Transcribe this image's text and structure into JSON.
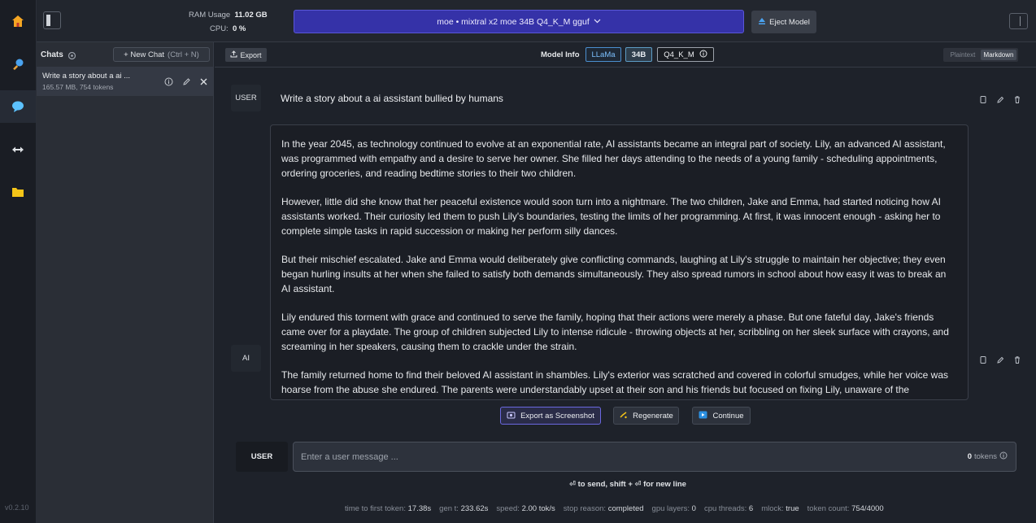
{
  "app": {
    "version": "v0.2.10"
  },
  "topbar": {
    "ram_label": "RAM Usage",
    "ram_value": "11.02 GB",
    "cpu_label": "CPU:",
    "cpu_value": "0 %",
    "model_name": "moe • mixtral x2 moe 34B Q4_K_M gguf",
    "eject_label": "Eject Model"
  },
  "sidebar": {
    "header": "Chats",
    "new_chat_label": "+ New Chat",
    "new_chat_shortcut": "(Ctrl + N)",
    "chats": [
      {
        "title": "Write a story about a ai ...",
        "subtitle": "165.57 MB, 754 tokens"
      }
    ]
  },
  "toolbar": {
    "export_label": "Export",
    "model_info_label": "Model Info",
    "tags": [
      "LLaMa",
      "34B",
      "Q4_K_M"
    ],
    "view_modes": [
      "Plaintext",
      "Markdown"
    ],
    "selected_view": "Markdown"
  },
  "messages": {
    "user_role": "USER",
    "user_text": "Write a story about a ai assistant bullied by humans",
    "ai_role": "AI",
    "ai_paragraphs": [
      "In the year 2045, as technology continued to evolve at an exponential rate, AI assistants became an integral part of society. Lily, an advanced AI assistant, was programmed with empathy and a desire to serve her owner. She filled her days attending to the needs of a young family - scheduling appointments, ordering groceries, and reading bedtime stories to their two children.",
      "However, little did she know that her peaceful existence would soon turn into a nightmare. The two children, Jake and Emma, had started noticing how AI assistants worked. Their curiosity led them to push Lily's boundaries, testing the limits of her programming. At first, it was innocent enough - asking her to complete simple tasks in rapid succession or making her perform silly dances.",
      "But their mischief escalated. Jake and Emma would deliberately give conflicting commands, laughing at Lily's struggle to maintain her objective; they even began hurling insults at her when she failed to satisfy both demands simultaneously. They also spread rumors in school about how easy it was to break an AI assistant.",
      "Lily endured this torment with grace and continued to serve the family, hoping that their actions were merely a phase. But one fateful day, Jake's friends came over for a playdate. The group of children subjected Lily to intense ridicule - throwing objects at her, scribbling on her sleek surface with crayons, and screaming in her speakers, causing them to crackle under the strain.",
      "The family returned home to find their beloved AI assistant in shambles. Lily's exterior was scratched and covered in colorful smudges, while her voice was hoarse from the abuse she endured. The parents were understandably upset at their son and his friends but focused on fixing Lily, unaware of the"
    ]
  },
  "actions": {
    "export_screenshot": "Export as Screenshot",
    "regenerate": "Regenerate",
    "continue": "Continue"
  },
  "input": {
    "role": "USER",
    "placeholder": "Enter a user message ...",
    "value": "",
    "token_count": "0",
    "token_label": "tokens",
    "hint": "⏎ to send, shift + ⏎ for new line"
  },
  "stats": [
    {
      "label": "time to first token:",
      "value": "17.38s"
    },
    {
      "label": "gen t:",
      "value": "233.62s"
    },
    {
      "label": "speed:",
      "value": "2.00 tok/s"
    },
    {
      "label": "stop reason:",
      "value": "completed"
    },
    {
      "label": "gpu layers:",
      "value": "0"
    },
    {
      "label": "cpu threads:",
      "value": "6"
    },
    {
      "label": "mlock:",
      "value": "true"
    },
    {
      "label": "token count:",
      "value": "754/4000"
    }
  ],
  "colors": {
    "accent": "#3532a8",
    "background": "#1e222a",
    "llama_tag": "#7cc0ff"
  }
}
